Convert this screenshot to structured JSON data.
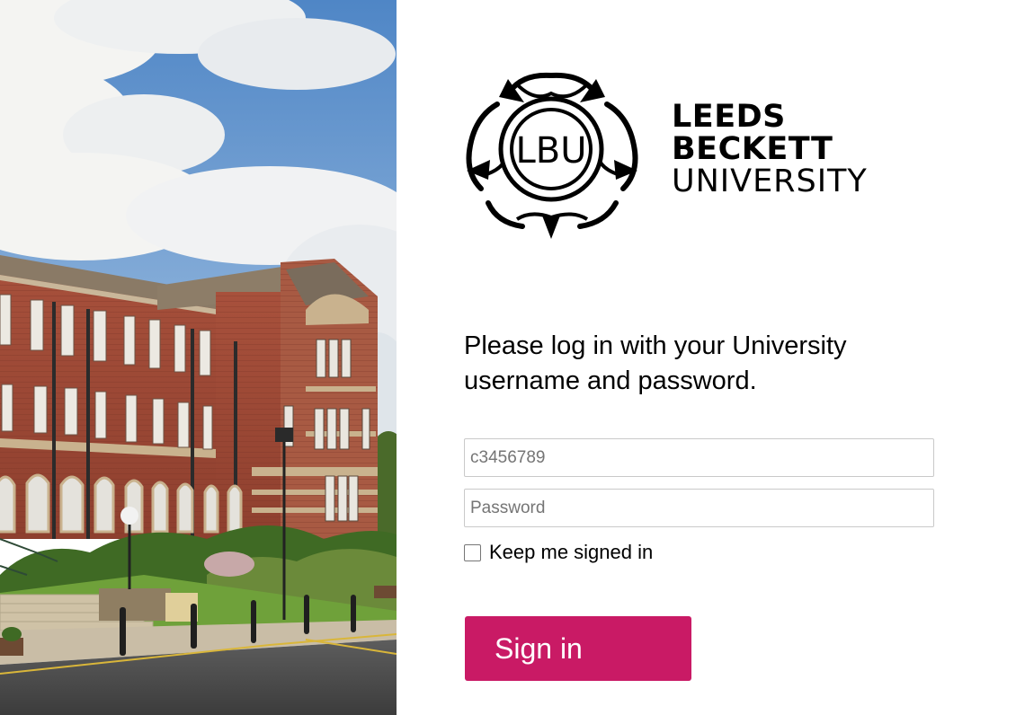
{
  "brand": {
    "seal_monogram": "LBU",
    "line1": "LEEDS",
    "line2": "BECKETT",
    "line3": "UNIVERSITY"
  },
  "prompt": "Please log in with your University username and password.",
  "username": {
    "value": "",
    "placeholder": "c3456789"
  },
  "password": {
    "value": "",
    "placeholder": "Password"
  },
  "keep_signed_in": {
    "label": "Keep me signed in",
    "checked": false
  },
  "signin": {
    "label": "Sign in"
  },
  "colors": {
    "accent": "#c91a65",
    "text": "#000000",
    "input_border": "#c9c9c9"
  },
  "hero_image": {
    "icon": "campus-building-photo"
  }
}
